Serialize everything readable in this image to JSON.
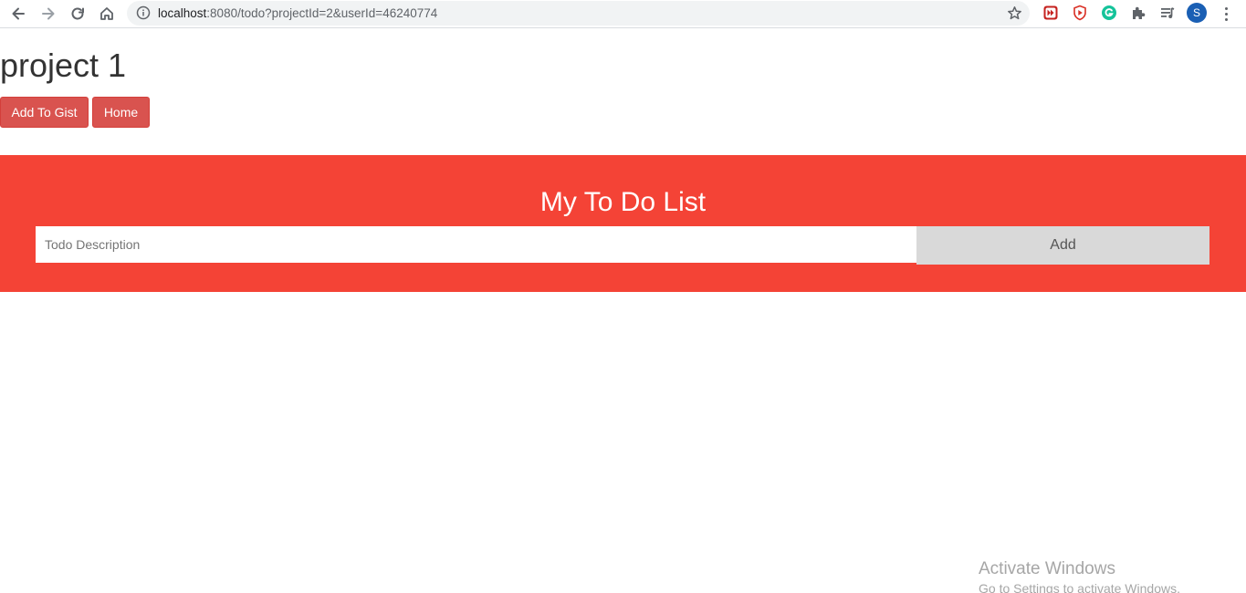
{
  "browser": {
    "url_host": "localhost",
    "url_rest": ":8080/todo?projectId=2&userId=46240774",
    "profile_initial": "S",
    "icons": [
      "back-arrow-icon",
      "forward-arrow-icon",
      "reload-icon",
      "home-icon",
      "info-icon",
      "bookmark-star-icon",
      "extension-red-icon",
      "shield-extension-icon",
      "grammarly-icon",
      "puzzle-extensions-icon",
      "media-queue-icon",
      "more-menu-icon"
    ]
  },
  "project": {
    "title": "project 1",
    "add_to_gist_label": "Add To Gist",
    "home_label": "Home"
  },
  "todo": {
    "heading": "My To Do List",
    "input_placeholder": "Todo Description",
    "input_value": "",
    "add_label": "Add"
  },
  "watermark": {
    "line1": "Activate Windows",
    "line2": "Go to Settings to activate Windows."
  },
  "colors": {
    "header_red": "#f44336",
    "button_red": "#d9534f",
    "add_button_gray": "#d9d9d9"
  }
}
